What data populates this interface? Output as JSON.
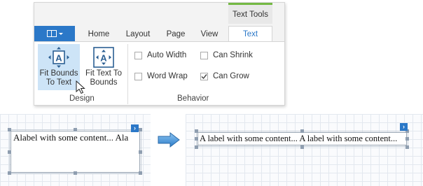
{
  "ribbon": {
    "contextual_header": "Text Tools",
    "tabs": [
      {
        "label": "Home"
      },
      {
        "label": "Layout"
      },
      {
        "label": "Page"
      },
      {
        "label": "View"
      },
      {
        "label": "Text",
        "active": true
      }
    ],
    "design_group": {
      "label": "Design",
      "fit_bounds_to_text": "Fit Bounds To Text",
      "fit_text_to_bounds": "Fit Text To Bounds"
    },
    "behavior_group": {
      "label": "Behavior",
      "auto_width": {
        "label": "Auto Width",
        "checked": false
      },
      "word_wrap": {
        "label": "Word Wrap",
        "checked": false
      },
      "can_shrink": {
        "label": "Can Shrink",
        "checked": false
      },
      "can_grow": {
        "label": "Can Grow",
        "checked": true
      }
    }
  },
  "before_label": {
    "text": "Alabel with some content... Ala"
  },
  "after_label": {
    "text": "A label with some content... A label with some content..."
  },
  "colors": {
    "accent": "#2b78c8",
    "context_tab": "#74b843",
    "selected": "#cde4f7"
  }
}
